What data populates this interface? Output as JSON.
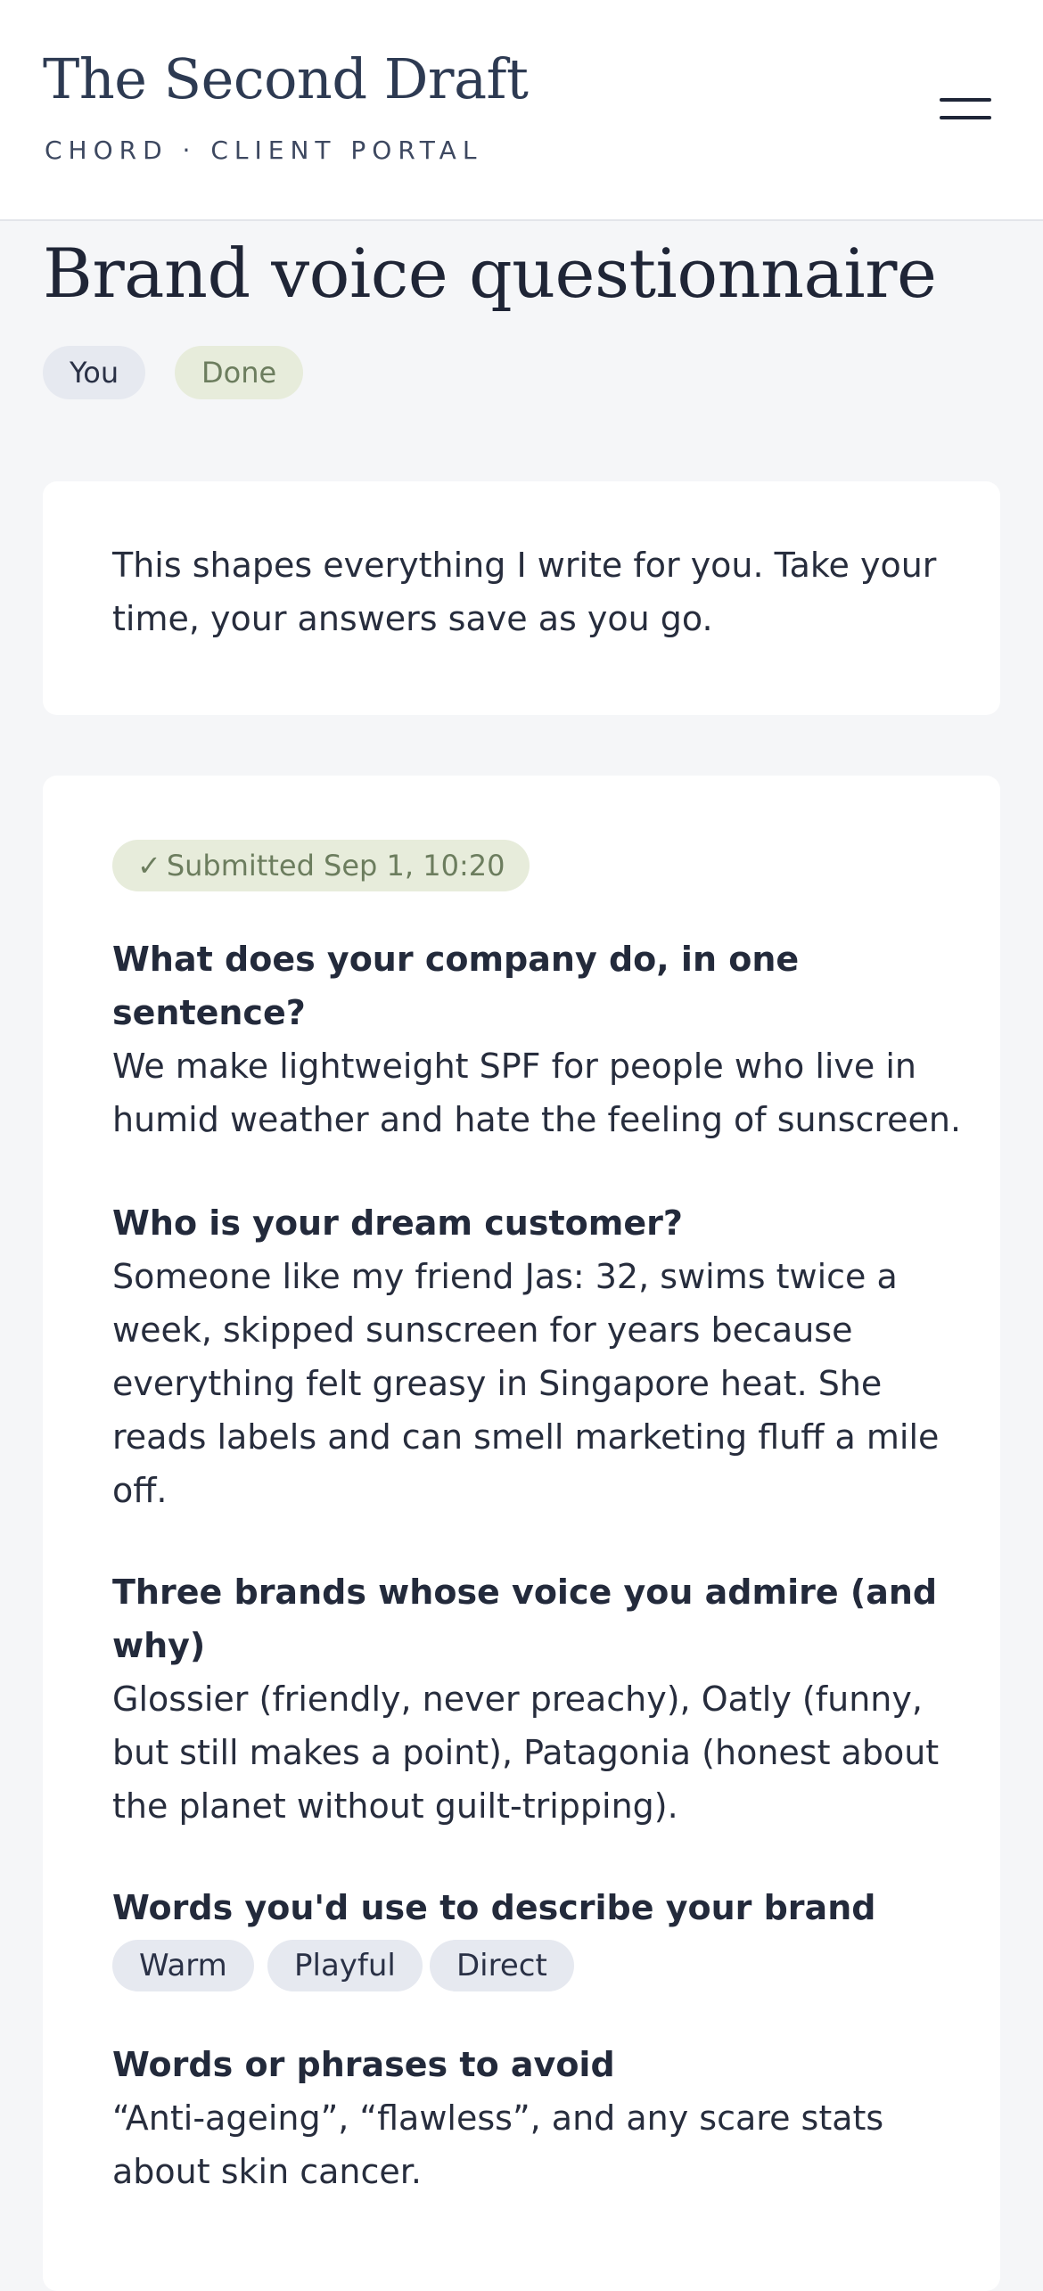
{
  "header": {
    "title": "The Second Draft",
    "subtitle": "CHORD · CLIENT PORTAL",
    "menu_icon": "hamburger-menu-icon"
  },
  "page": {
    "title": "Brand voice questionnaire",
    "assignee_pill": "You",
    "status_pill": "Done"
  },
  "intro": {
    "text": "This shapes everything I write for you. Take your time, your answers save as you go."
  },
  "submission": {
    "check_glyph": "✓",
    "badge": "Submitted Sep 1, 10:20"
  },
  "questions": [
    {
      "question": "What does your company do, in one sentence?",
      "answer": "We make lightweight SPF for people who live in humid weather and hate the feeling of sunscreen."
    },
    {
      "question": "Who is your dream customer?",
      "answer": "Someone like my friend Jas: 32, swims twice a week, skipped sunscreen for years because everything felt greasy in Singapore heat. She reads labels and can smell marketing fluff a mile off."
    },
    {
      "question": "Three brands whose voice you admire (and why)",
      "answer": "Glossier (friendly, never preachy), Oatly (funny, but still makes a point), Patagonia (honest about the planet without guilt-tripping)."
    },
    {
      "question": "Words you'd use to describe your brand",
      "tags": [
        "Warm",
        "Playful",
        "Direct"
      ]
    },
    {
      "question": "Words or phrases to avoid",
      "answer": "“Anti-ageing”, “flawless”, and any scare stats about skin cancer."
    }
  ],
  "colors": {
    "background": "#f5f6f8",
    "card": "#ffffff",
    "done_pill_bg": "#e7ecdb",
    "done_pill_text": "#6c7d5e",
    "neutral_pill_bg": "#e6e9f0",
    "brand_text": "#2d3a52"
  }
}
